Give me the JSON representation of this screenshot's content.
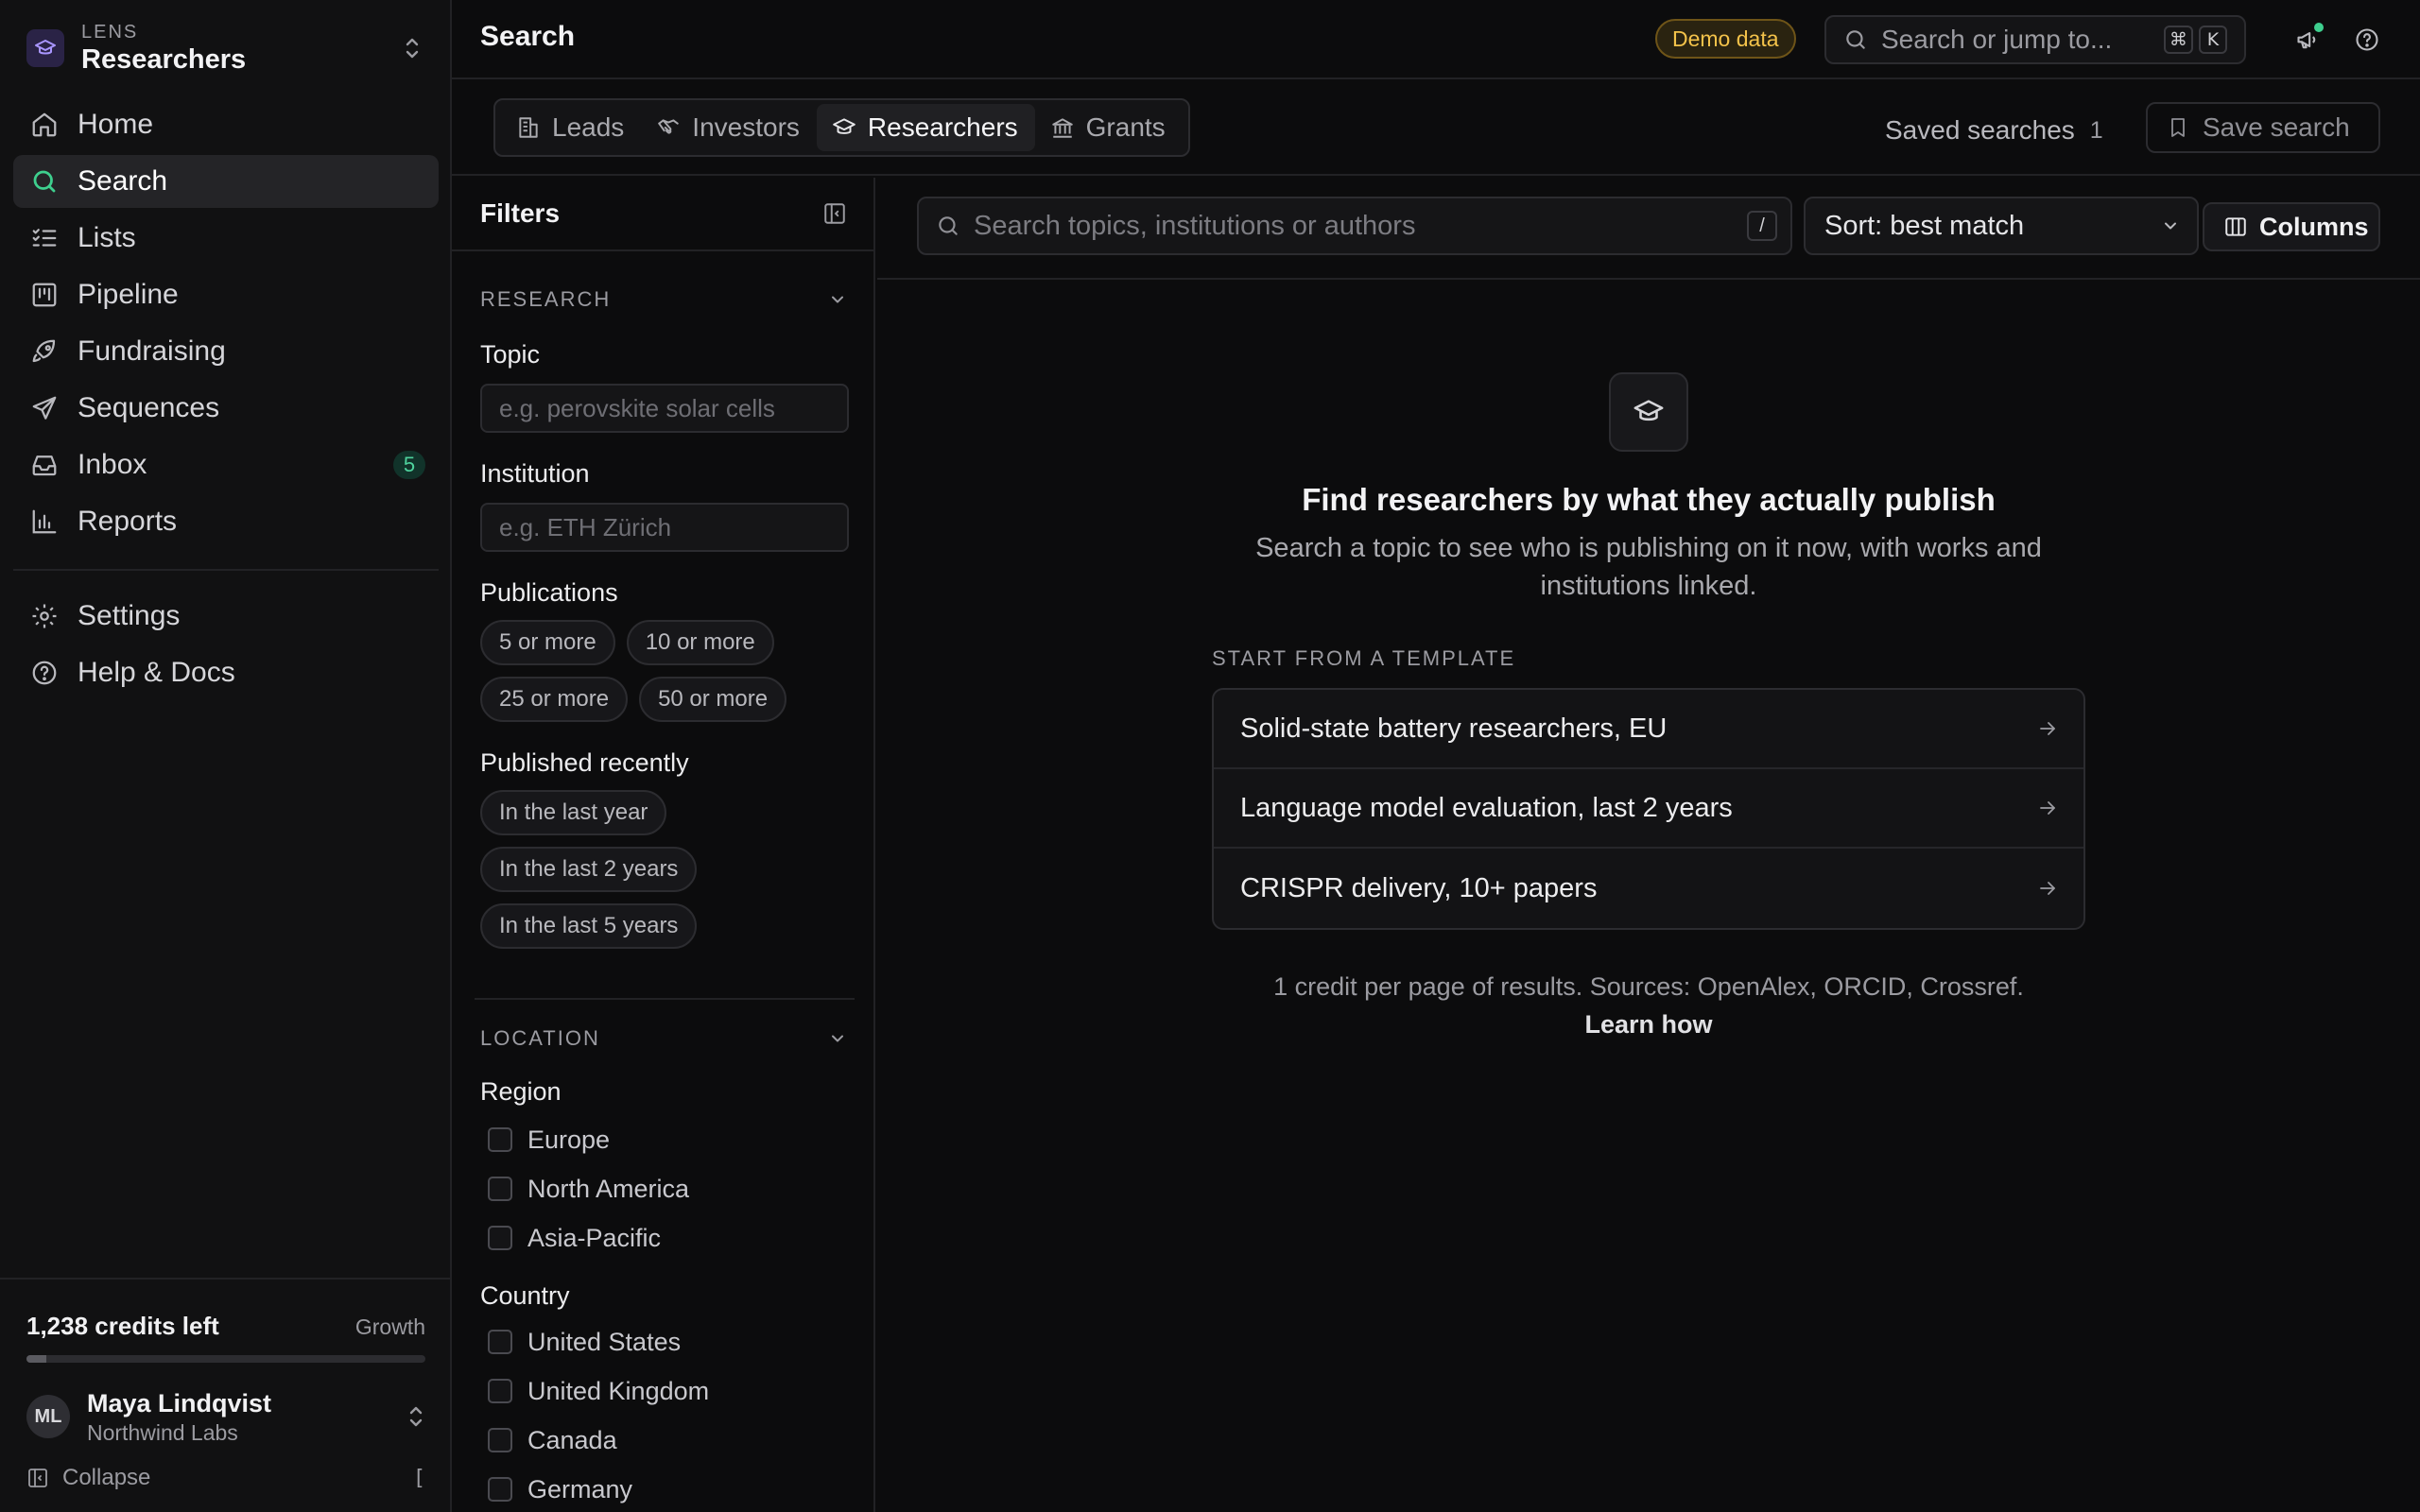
{
  "workspace": {
    "eyebrow": "LENS",
    "name": "Researchers"
  },
  "nav": {
    "items": [
      {
        "label": "Home",
        "icon": "home-icon"
      },
      {
        "label": "Search",
        "icon": "search-icon",
        "active": true
      },
      {
        "label": "Lists",
        "icon": "list-icon"
      },
      {
        "label": "Pipeline",
        "icon": "kanban-icon"
      },
      {
        "label": "Fundraising",
        "icon": "rocket-icon"
      },
      {
        "label": "Sequences",
        "icon": "send-icon"
      },
      {
        "label": "Inbox",
        "icon": "inbox-icon",
        "badge": "5"
      },
      {
        "label": "Reports",
        "icon": "bar-chart-icon"
      }
    ],
    "secondary": [
      {
        "label": "Settings",
        "icon": "gear-icon"
      },
      {
        "label": "Help & Docs",
        "icon": "help-icon"
      }
    ]
  },
  "credits": {
    "text": "1,238 credits left",
    "plan": "Growth",
    "used_fraction": 0.05
  },
  "user": {
    "initials": "ML",
    "name": "Maya Lindqvist",
    "org": "Northwind Labs"
  },
  "collapse": {
    "label": "Collapse",
    "shortcut": "["
  },
  "topbar": {
    "title": "Search",
    "demo_badge": "Demo data",
    "jump_placeholder": "Search or jump to...",
    "kbd_mod": "⌘",
    "kbd_key": "K"
  },
  "tabs": [
    {
      "label": "Leads",
      "icon": "building-icon"
    },
    {
      "label": "Investors",
      "icon": "handshake-icon"
    },
    {
      "label": "Researchers",
      "icon": "graduation-cap-icon",
      "active": true
    },
    {
      "label": "Grants",
      "icon": "bank-icon"
    }
  ],
  "saved": {
    "label": "Saved searches",
    "count": "1",
    "save_label": "Save search"
  },
  "filters": {
    "title": "Filters",
    "research": {
      "title": "RESEARCH",
      "topic_label": "Topic",
      "topic_placeholder": "e.g. perovskite solar cells",
      "institution_label": "Institution",
      "institution_placeholder": "e.g. ETH Zürich",
      "publications_label": "Publications",
      "publications_options": [
        "5 or more",
        "10 or more",
        "25 or more",
        "50 or more"
      ],
      "recent_label": "Published recently",
      "recent_options": [
        "In the last year",
        "In the last 2 years",
        "In the last 5 years"
      ]
    },
    "location": {
      "title": "LOCATION",
      "region_label": "Region",
      "regions": [
        "Europe",
        "North America",
        "Asia-Pacific"
      ],
      "country_label": "Country",
      "countries": [
        "United States",
        "United Kingdom",
        "Canada",
        "Germany"
      ]
    }
  },
  "main": {
    "search_placeholder": "Search topics, institutions or authors",
    "search_shortcut": "/",
    "sort_label": "Sort: best match",
    "columns_label": "Columns",
    "empty_title": "Find researchers by what they actually publish",
    "empty_sub": "Search a topic to see who is publishing on it now, with works and institutions linked.",
    "templates_head": "START FROM A TEMPLATE",
    "templates": [
      "Solid-state battery researchers, EU",
      "Language model evaluation, last 2 years",
      "CRISPR delivery, 10+ papers"
    ],
    "credit_note": "1 credit per page of results. Sources: OpenAlex, ORCID, Crossref.",
    "learn_label": "Learn how"
  },
  "colors": {
    "accent": "#3ecf8e",
    "warning": "#f3c24a",
    "bg": "#0c0c0d",
    "panel": "#111112"
  }
}
